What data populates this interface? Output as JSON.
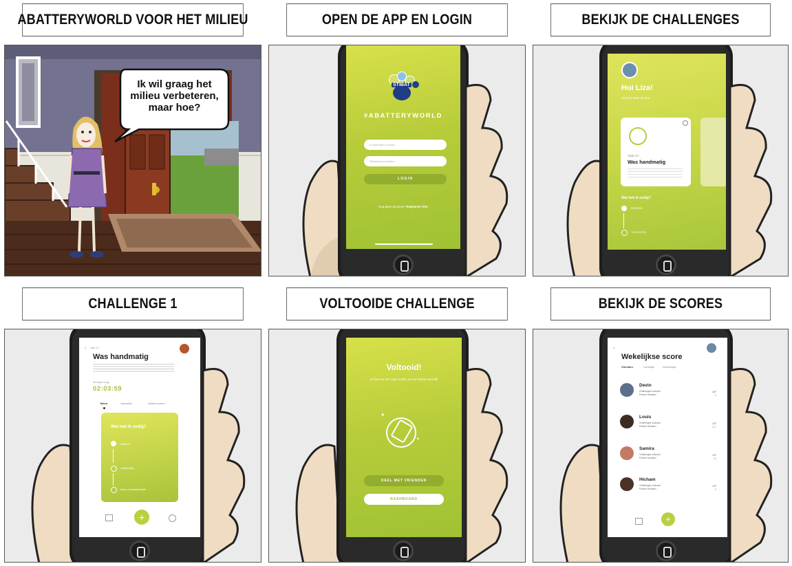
{
  "titles": [
    "ABATTERYWORLD VOOR HET MILIEU",
    "OPEN DE APP EN LOGIN",
    "BEKIJK DE CHALLENGES",
    "CHALLENGE 1",
    "VOLTOOIDE CHALLENGE",
    "BEKIJK DE SCORES"
  ],
  "scene1": {
    "speech": [
      "Ik wil graag het",
      "milieu verbeteren,",
      "maar hoe?"
    ]
  },
  "login": {
    "logo_text": "STIBAT",
    "hashtag": "#ABATTERYWORLD",
    "button": "LOGIN",
    "email_placeholder": "E-mail adres invullen",
    "password_placeholder": "Wachtwoord invullen",
    "register_prefix": "Nog geen account?",
    "register_link": "Registreer hier"
  },
  "challenges": {
    "greeting": "Hoi Liza!",
    "sub": "Goed je weer te zien",
    "task": "Task 1/7",
    "card_title": "Was handmatig",
    "need": "Wat heb ik nodig?",
    "item1": "Camera",
    "item2": "Vaatdoekje"
  },
  "challenge1": {
    "task": "Task 1/7",
    "title": "Was handmatig",
    "time_label": "Te lopen nog:",
    "timer": "02:03:59",
    "tabs": [
      "Taken",
      "Uploaden",
      "Aantal punten"
    ],
    "card_title": "Wat heb ik nodig?",
    "items": [
      "Camera",
      "Vaatdoekje",
      "Zeep of afwasmiddel"
    ]
  },
  "done": {
    "title": "Voltooid!",
    "sub": "Je kunt nu een stap verder, tot een betere wereld!",
    "share": "DEEL MET VRIENDEN",
    "dashboard": "DASHBOARD"
  },
  "scores": {
    "title": "Wekelijkse score",
    "tabs": [
      "Vrienden",
      "Landelijk",
      "Wereldwijd"
    ],
    "people": [
      {
        "name": "Devin",
        "score": "4/7",
        "pts": "6"
      },
      {
        "name": "Louis",
        "score": "1/7",
        "pts": "112"
      },
      {
        "name": "Samira",
        "score": "1/7",
        "pts": "25"
      },
      {
        "name": "Hicham",
        "score": "1/7",
        "pts": "6"
      }
    ],
    "line1": "Challenges voltooid",
    "line2": "Punten behalen"
  },
  "colors": {
    "accent": "#b6cc3c",
    "border": "#555555"
  }
}
